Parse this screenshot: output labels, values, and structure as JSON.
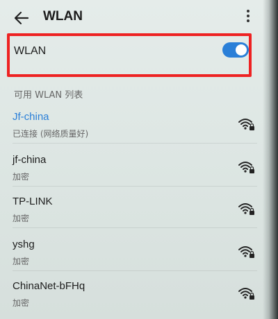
{
  "header": {
    "title": "WLAN",
    "back_icon": "back-arrow-icon",
    "more_icon": "more-vertical-icon"
  },
  "wlan_toggle": {
    "label": "WLAN",
    "state": "on",
    "accent_color": "#2a7fd8",
    "highlight_color": "#ee2222"
  },
  "available_section": {
    "title": "可用 WLAN 列表"
  },
  "networks": [
    {
      "name": "Jf-china",
      "status": "已连接 (网络质量好)",
      "connected": true,
      "icon": "wifi-lock-icon"
    },
    {
      "name": "jf-china",
      "status": "加密",
      "connected": false,
      "icon": "wifi-lock-icon"
    },
    {
      "name": "TP-LINK",
      "status": "加密",
      "connected": false,
      "icon": "wifi-lock-icon"
    },
    {
      "name": "yshg",
      "status": "加密",
      "connected": false,
      "icon": "wifi-lock-icon"
    },
    {
      "name": "ChinaNet-bFHq",
      "status": "加密",
      "connected": false,
      "icon": "wifi-lock-icon"
    }
  ]
}
